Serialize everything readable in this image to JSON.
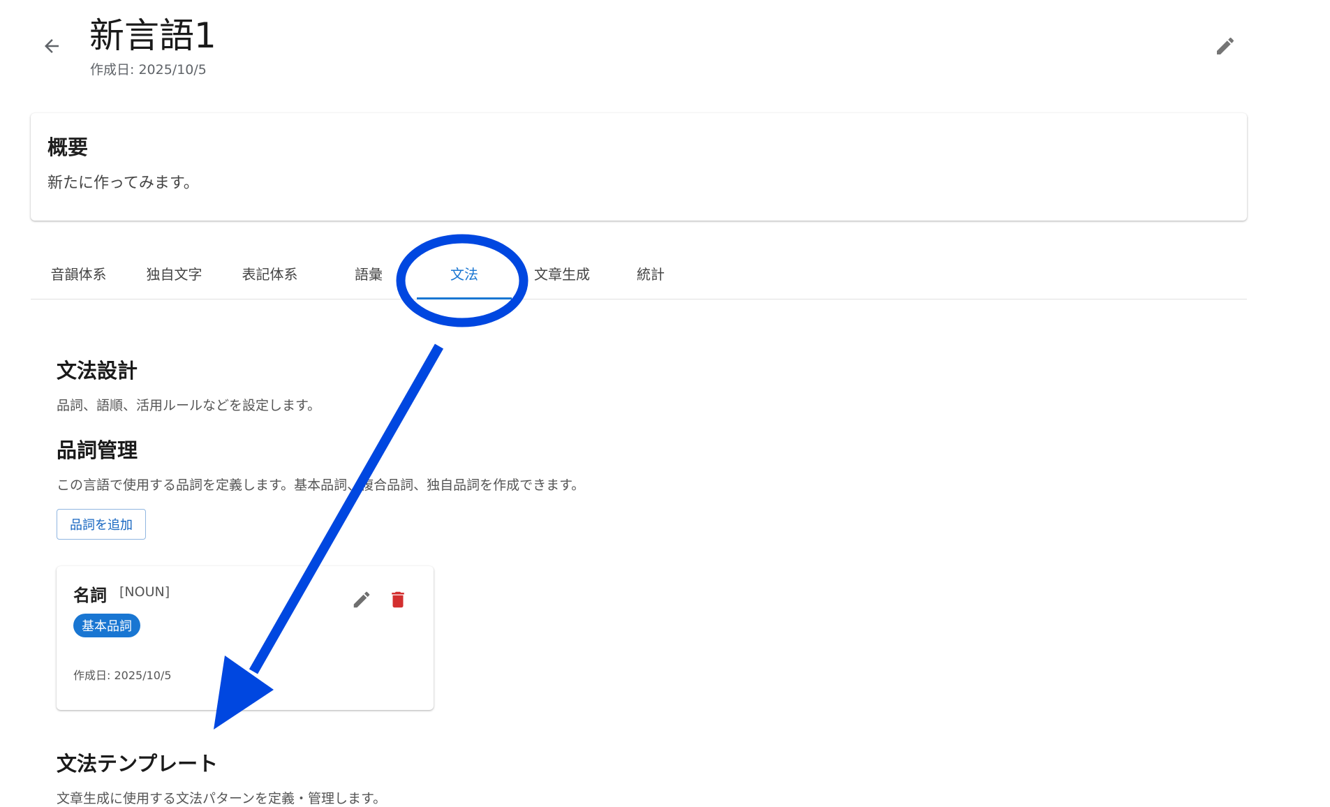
{
  "header": {
    "back_icon": "arrow-left-icon",
    "title": "新言語1",
    "created": "作成日: 2025/10/5",
    "edit_icon": "pencil-icon"
  },
  "overview": {
    "title": "概要",
    "text": "新たに作ってみます。"
  },
  "tabs": [
    {
      "label": "音韻体系",
      "active": false
    },
    {
      "label": "独自文字",
      "active": false
    },
    {
      "label": "表記体系",
      "active": false
    },
    {
      "label": "語彙",
      "active": false
    },
    {
      "label": "文法",
      "active": true
    },
    {
      "label": "文章生成",
      "active": false
    },
    {
      "label": "統計",
      "active": false
    }
  ],
  "grammar": {
    "title": "文法設計",
    "description": "品詞、語順、活用ルールなどを設定します。"
  },
  "pos_management": {
    "title": "品詞管理",
    "description": "この言語で使用する品詞を定義します。基本品詞、複合品詞、独自品詞を作成できます。",
    "add_button": "品詞を追加",
    "cards": [
      {
        "name": "名詞",
        "code": "[NOUN]",
        "badge": "基本品詞",
        "created": "作成日: 2025/10/5",
        "edit_icon": "pencil-icon",
        "delete_icon": "trash-icon"
      }
    ]
  },
  "templates": {
    "title": "文法テンプレート",
    "description": "文章生成に使用する文法パターンを定義・管理します。"
  },
  "colors": {
    "accent": "#1976d2",
    "delete": "#d32f2f",
    "annotation": "#0047e0"
  }
}
